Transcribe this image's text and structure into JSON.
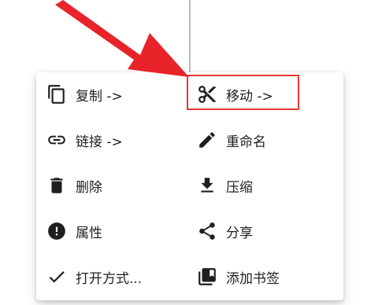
{
  "menu": {
    "left_column": [
      {
        "label": "复制 ->",
        "icon": "copy-icon"
      },
      {
        "label": "链接 ->",
        "icon": "link-icon"
      },
      {
        "label": "删除",
        "icon": "trash-icon"
      },
      {
        "label": "属性",
        "icon": "info-icon"
      },
      {
        "label": "打开方式...",
        "icon": "check-icon"
      }
    ],
    "right_column": [
      {
        "label": "移动 ->",
        "icon": "cut-icon"
      },
      {
        "label": "重命名",
        "icon": "pencil-icon"
      },
      {
        "label": "压缩",
        "icon": "download-icon"
      },
      {
        "label": "分享",
        "icon": "share-icon"
      },
      {
        "label": "添加书签",
        "icon": "bookmark-icon"
      }
    ]
  },
  "annotation": {
    "arrow_color": "#e8232a",
    "highlight_color": "#e53935",
    "highlighted_item": "移动 ->"
  }
}
